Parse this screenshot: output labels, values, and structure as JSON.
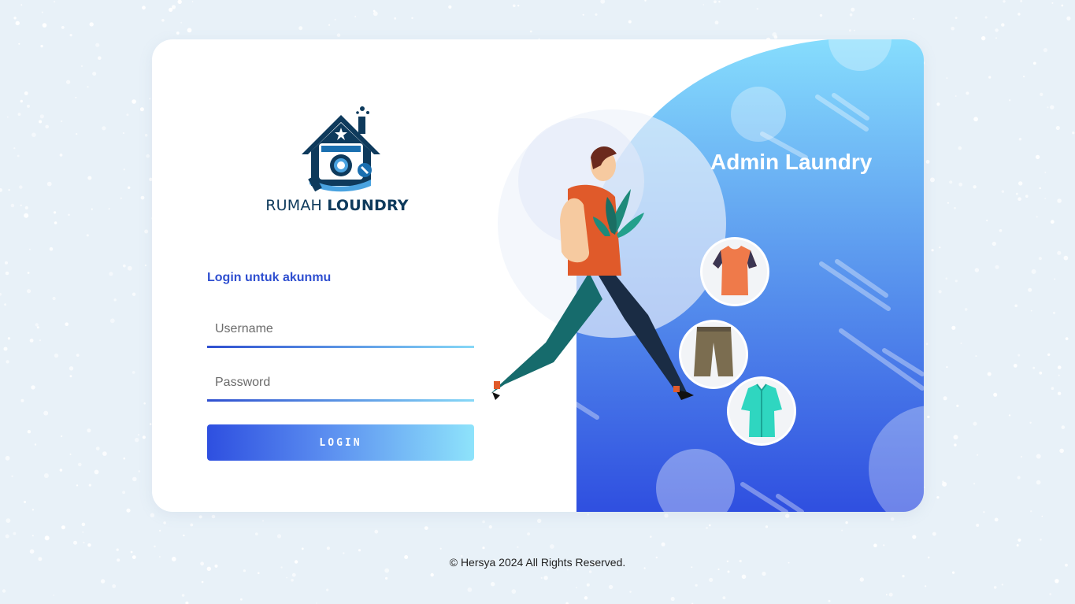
{
  "brand": {
    "name_part1": "RUMAH",
    "name_part2": "LOUNDRY"
  },
  "login": {
    "heading": "Login untuk akunmu",
    "username_placeholder": "Username",
    "username_value": "",
    "password_placeholder": "Password",
    "password_value": "",
    "button_label": "LOGIN"
  },
  "panel": {
    "title": "Admin Laundry"
  },
  "footer": {
    "text": "© Hersya 2024 All Rights Reserved."
  },
  "icons": {
    "logo": "laundry-house-logo-icon",
    "tshirt": "tshirt-icon",
    "shorts": "shorts-icon",
    "shirt": "shirt-icon"
  },
  "colors": {
    "accent": "#2f4fd0",
    "gradient_start": "#2e4fe0",
    "gradient_end": "#8ee3fb",
    "logo_navy": "#0e3a5c"
  }
}
